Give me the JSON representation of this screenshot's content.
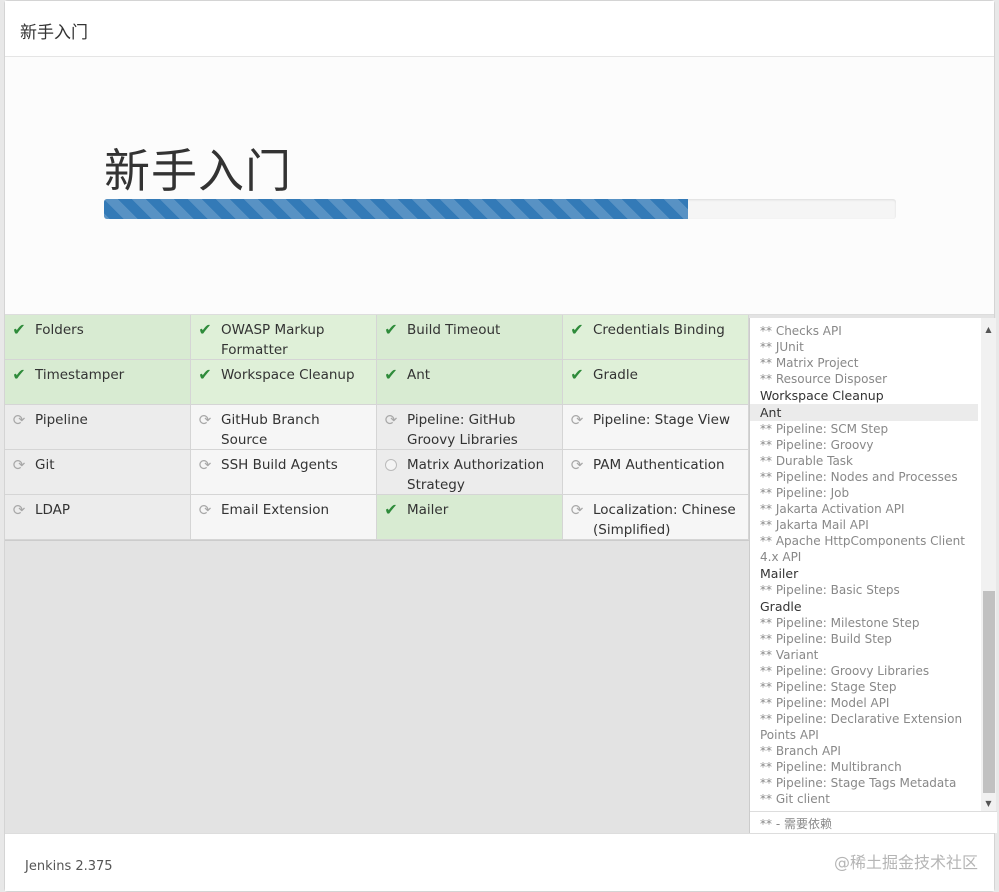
{
  "header": {
    "title": "新手入门"
  },
  "hero": {
    "title": "新手入门",
    "progress_fraction": 0.737
  },
  "plugins": [
    {
      "name": "Folders",
      "status": "installed"
    },
    {
      "name": "OWASP Markup Formatter",
      "status": "installed"
    },
    {
      "name": "Build Timeout",
      "status": "installed"
    },
    {
      "name": "Credentials Binding",
      "status": "installed"
    },
    {
      "name": "Timestamper",
      "status": "installed"
    },
    {
      "name": "Workspace Cleanup",
      "status": "installed"
    },
    {
      "name": "Ant",
      "status": "installed"
    },
    {
      "name": "Gradle",
      "status": "installed"
    },
    {
      "name": "Pipeline",
      "status": "pending"
    },
    {
      "name": "GitHub Branch Source",
      "status": "pending"
    },
    {
      "name": "Pipeline: GitHub Groovy Libraries",
      "status": "pending"
    },
    {
      "name": "Pipeline: Stage View",
      "status": "pending"
    },
    {
      "name": "Git",
      "status": "pending"
    },
    {
      "name": "SSH Build Agents",
      "status": "pending"
    },
    {
      "name": "Matrix Authorization Strategy",
      "status": "queued"
    },
    {
      "name": "PAM Authentication",
      "status": "pending"
    },
    {
      "name": "LDAP",
      "status": "pending"
    },
    {
      "name": "Email Extension",
      "status": "pending"
    },
    {
      "name": "Mailer",
      "status": "installed"
    },
    {
      "name": "Localization: Chinese (Simplified)",
      "status": "pending"
    }
  ],
  "log": {
    "lines": [
      {
        "text": "** Checks API",
        "kind": "sub"
      },
      {
        "text": "** JUnit",
        "kind": "sub"
      },
      {
        "text": "** Matrix Project",
        "kind": "sub"
      },
      {
        "text": "** Resource Disposer",
        "kind": "sub"
      },
      {
        "text": "Workspace Cleanup",
        "kind": "main"
      },
      {
        "text": "Ant",
        "kind": "main active"
      },
      {
        "text": "** Pipeline: SCM Step",
        "kind": "sub"
      },
      {
        "text": "** Pipeline: Groovy",
        "kind": "sub"
      },
      {
        "text": "** Durable Task",
        "kind": "sub"
      },
      {
        "text": "** Pipeline: Nodes and Processes",
        "kind": "sub"
      },
      {
        "text": "** Pipeline: Job",
        "kind": "sub"
      },
      {
        "text": "** Jakarta Activation API",
        "kind": "sub"
      },
      {
        "text": "** Jakarta Mail API",
        "kind": "sub"
      },
      {
        "text": "** Apache HttpComponents Client 4.x API",
        "kind": "sub"
      },
      {
        "text": "Mailer",
        "kind": "main"
      },
      {
        "text": "** Pipeline: Basic Steps",
        "kind": "sub"
      },
      {
        "text": "Gradle",
        "kind": "main"
      },
      {
        "text": "** Pipeline: Milestone Step",
        "kind": "sub"
      },
      {
        "text": "** Pipeline: Build Step",
        "kind": "sub"
      },
      {
        "text": "** Variant",
        "kind": "sub"
      },
      {
        "text": "** Pipeline: Groovy Libraries",
        "kind": "sub"
      },
      {
        "text": "** Pipeline: Stage Step",
        "kind": "sub"
      },
      {
        "text": "** Pipeline: Model API",
        "kind": "sub"
      },
      {
        "text": "** Pipeline: Declarative Extension Points API",
        "kind": "sub"
      },
      {
        "text": "** Branch API",
        "kind": "sub"
      },
      {
        "text": "** Pipeline: Multibranch",
        "kind": "sub"
      },
      {
        "text": "** Pipeline: Stage Tags Metadata",
        "kind": "sub"
      },
      {
        "text": "** Git client",
        "kind": "sub"
      }
    ],
    "legend": "** - 需要依赖"
  },
  "footer": {
    "version": "Jenkins 2.375",
    "watermark": "@稀土掘金技术社区"
  },
  "colors": {
    "accent": "#337ab7",
    "installed_bg": "#dff0d8",
    "check": "#2e8b3a"
  }
}
